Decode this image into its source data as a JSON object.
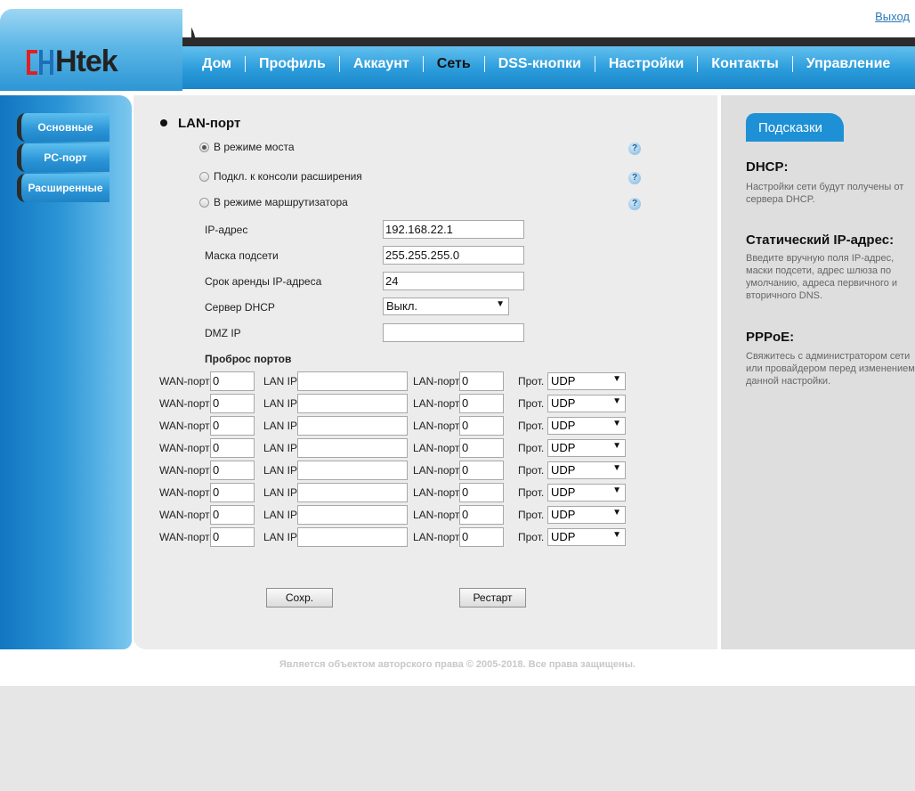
{
  "header": {
    "logout": "Выход",
    "logo_text": "Htek",
    "nav": [
      {
        "label": "Дом"
      },
      {
        "label": "Профиль"
      },
      {
        "label": "Аккаунт"
      },
      {
        "label": "Сеть"
      },
      {
        "label": "DSS-кнопки"
      },
      {
        "label": "Настройки"
      },
      {
        "label": "Контакты"
      },
      {
        "label": "Управление"
      }
    ],
    "active_nav": "Сеть"
  },
  "sidebar": {
    "items": [
      {
        "label": "Основные"
      },
      {
        "label": "PC-порт"
      },
      {
        "label": "Расширенные"
      }
    ]
  },
  "main": {
    "title": "LAN-порт",
    "modes": [
      {
        "label": "В режиме моста",
        "selected": true
      },
      {
        "label": "Подкл. к консоли расширения",
        "selected": false
      },
      {
        "label": "В режиме маршрутизатора",
        "selected": false
      }
    ],
    "help_glyph": "?",
    "fields": {
      "ip_label": "IP-адрес",
      "ip_value": "192.168.22.1",
      "mask_label": "Маска подсети",
      "mask_value": "255.255.255.0",
      "lease_label": "Срок аренды IP-адреса",
      "lease_value": "24",
      "dhcp_label": "Сервер DHCP",
      "dhcp_value": "Выкл.",
      "dmz_label": "DMZ IP",
      "dmz_value": ""
    },
    "forward": {
      "title": "Проброс портов",
      "wan_label": "WAN-порт",
      "lanip_label": "LAN IP",
      "lanport_label": "LAN-порт",
      "proto_label": "Прот.",
      "rows": [
        {
          "wan": "0",
          "lanip": "",
          "lanport": "0",
          "proto": "UDP"
        },
        {
          "wan": "0",
          "lanip": "",
          "lanport": "0",
          "proto": "UDP"
        },
        {
          "wan": "0",
          "lanip": "",
          "lanport": "0",
          "proto": "UDP"
        },
        {
          "wan": "0",
          "lanip": "",
          "lanport": "0",
          "proto": "UDP"
        },
        {
          "wan": "0",
          "lanip": "",
          "lanport": "0",
          "proto": "UDP"
        },
        {
          "wan": "0",
          "lanip": "",
          "lanport": "0",
          "proto": "UDP"
        },
        {
          "wan": "0",
          "lanip": "",
          "lanport": "0",
          "proto": "UDP"
        },
        {
          "wan": "0",
          "lanip": "",
          "lanport": "0",
          "proto": "UDP"
        }
      ]
    },
    "save_label": "Сохр.",
    "restart_label": "Рестарт"
  },
  "tips": {
    "tab": "Подсказки",
    "items": [
      {
        "title": "DHCP:",
        "text": "Настройки сети будут получены от сервера DHCP."
      },
      {
        "title": "Статический IP-адрес:",
        "text": "Введите вручную поля IP-адрес, маски подсети, адрес шлюза по умолчанию, адреса первичного и вторичного DNS."
      },
      {
        "title": "PPPoE:",
        "text": "Свяжитесь с администратором сети или провайдером перед изменением данной настройки."
      }
    ]
  },
  "footer": "Является объектом авторского права © 2005-2018. Все права защищены.",
  "colors": {
    "accent": "#1e90d6",
    "nav_dark": "#2b2b2b",
    "logo_red": "#e02020"
  }
}
